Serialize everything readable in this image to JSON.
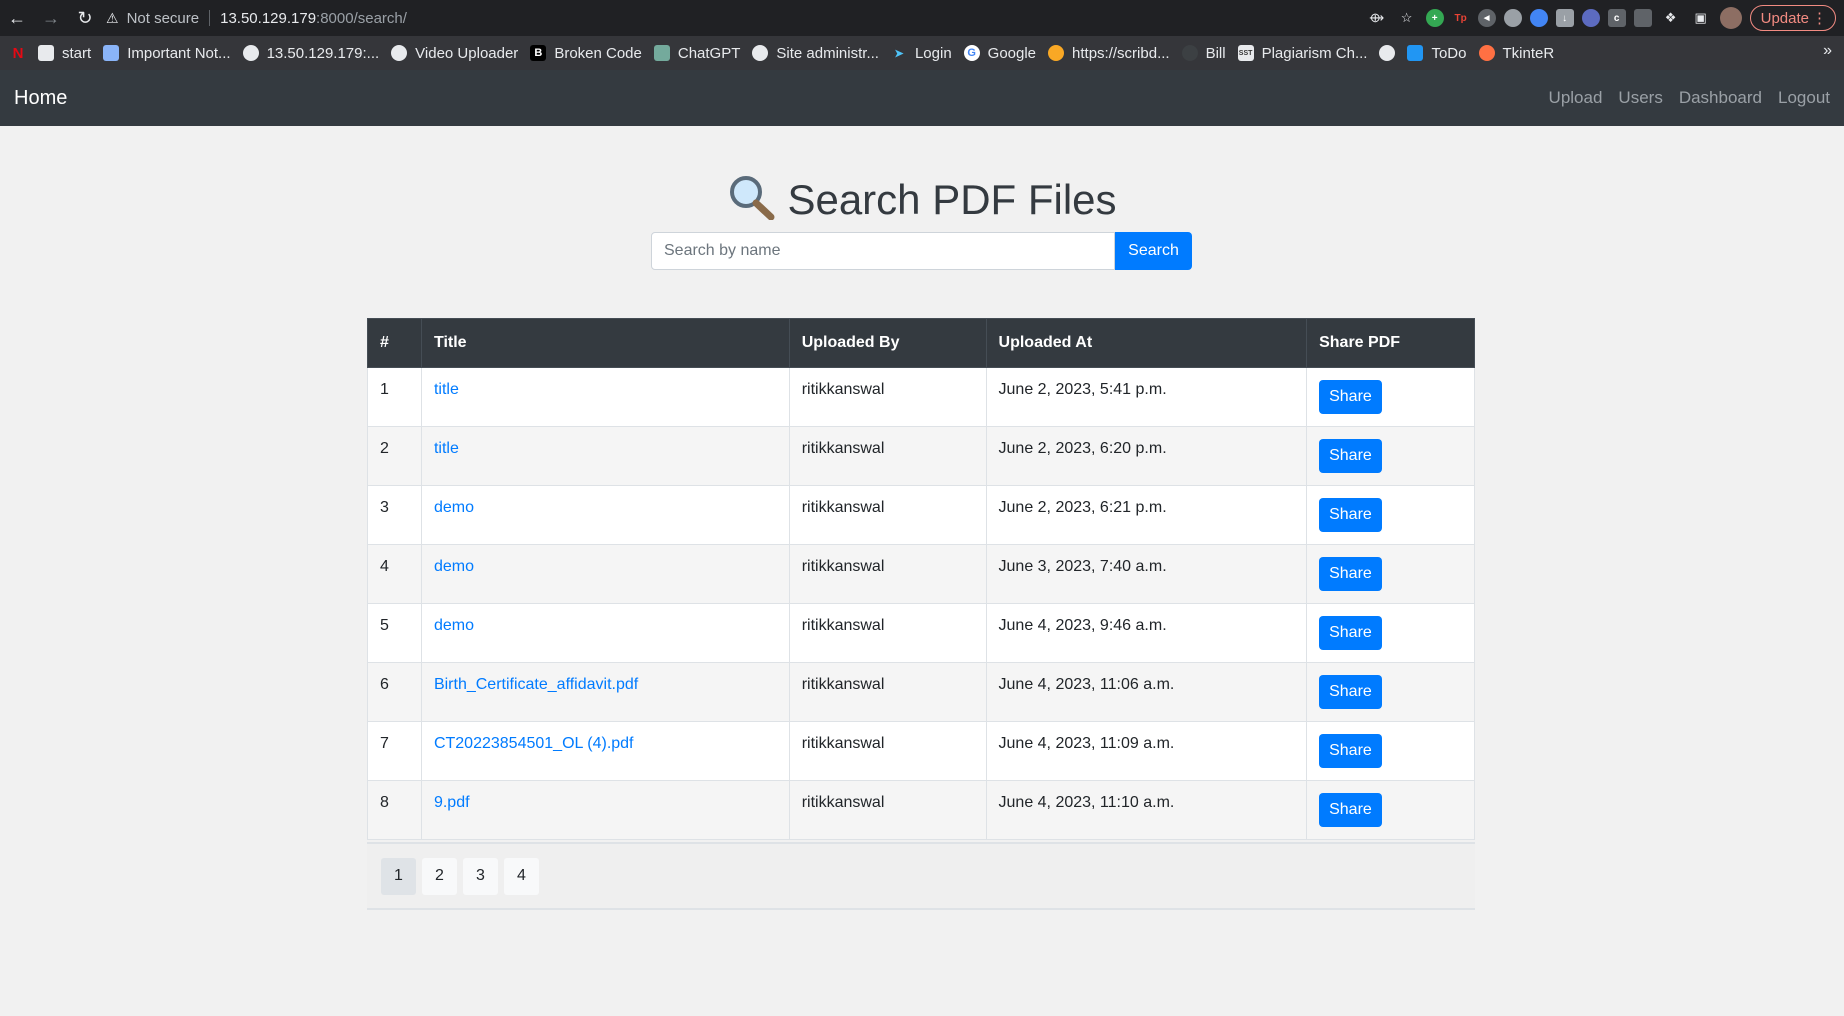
{
  "browser": {
    "security_text": "Not secure",
    "url_host": "13.50.129.179",
    "url_path": ":8000/search/",
    "update_label": "Update",
    "bookmarks": [
      {
        "label": "start",
        "icon": "folder-icon"
      },
      {
        "label": "Important Not...",
        "icon": "notes-icon"
      },
      {
        "label": "13.50.129.179:...",
        "icon": "globe-icon"
      },
      {
        "label": "Video Uploader",
        "icon": "globe-icon"
      },
      {
        "label": "Broken Code",
        "icon": "b-icon"
      },
      {
        "label": "ChatGPT",
        "icon": "chatgpt-icon"
      },
      {
        "label": "Site administr...",
        "icon": "globe-icon"
      },
      {
        "label": "Login",
        "icon": "arrow-icon"
      },
      {
        "label": "Google",
        "icon": "google-icon"
      },
      {
        "label": "https://scribd...",
        "icon": "scribd-icon"
      },
      {
        "label": "Bill",
        "icon": "bill-icon"
      },
      {
        "label": "Plagiarism Ch...",
        "icon": "sst-icon"
      },
      {
        "label": "",
        "icon": "globe-icon"
      },
      {
        "label": "ToDo",
        "icon": "todo-icon"
      },
      {
        "label": "TkinteR",
        "icon": "tkinter-icon"
      }
    ]
  },
  "navbar": {
    "brand": "Home",
    "links": [
      "Upload",
      "Users",
      "Dashboard",
      "Logout"
    ]
  },
  "search": {
    "heading": "Search PDF Files",
    "placeholder": "Search by name",
    "button_label": "Search"
  },
  "table": {
    "headers": [
      "#",
      "Title",
      "Uploaded By",
      "Uploaded At",
      "Share PDF"
    ],
    "rows": [
      {
        "num": "1",
        "title": "title",
        "by": "ritikkanswal",
        "at": "June 2, 2023, 5:41 p.m.",
        "share": "Share"
      },
      {
        "num": "2",
        "title": "title",
        "by": "ritikkanswal",
        "at": "June 2, 2023, 6:20 p.m.",
        "share": "Share"
      },
      {
        "num": "3",
        "title": "demo",
        "by": "ritikkanswal",
        "at": "June 2, 2023, 6:21 p.m.",
        "share": "Share"
      },
      {
        "num": "4",
        "title": "demo",
        "by": "ritikkanswal",
        "at": "June 3, 2023, 7:40 a.m.",
        "share": "Share"
      },
      {
        "num": "5",
        "title": "demo",
        "by": "ritikkanswal",
        "at": "June 4, 2023, 9:46 a.m.",
        "share": "Share"
      },
      {
        "num": "6",
        "title": "Birth_Certificate_affidavit.pdf",
        "by": "ritikkanswal",
        "at": "June 4, 2023, 11:06 a.m.",
        "share": "Share"
      },
      {
        "num": "7",
        "title": "CT20223854501_OL (4).pdf",
        "by": "ritikkanswal",
        "at": "June 4, 2023, 11:09 a.m.",
        "share": "Share"
      },
      {
        "num": "8",
        "title": "9.pdf",
        "by": "ritikkanswal",
        "at": "June 4, 2023, 11:10 a.m.",
        "share": "Share"
      }
    ]
  },
  "pagination": {
    "pages": [
      "1",
      "2",
      "3",
      "4"
    ],
    "active": "1"
  },
  "colors": {
    "navbar_bg": "#343a40",
    "primary": "#007bff",
    "page_bg": "#f1f1f1"
  }
}
